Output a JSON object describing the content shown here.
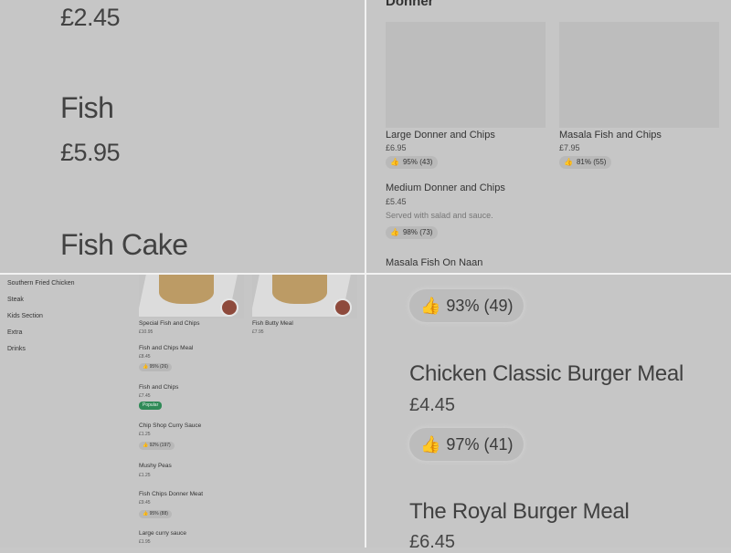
{
  "q1": {
    "top_price": "£2.45",
    "fish_name": "Fish",
    "fish_price": "£5.95",
    "fishcake_name": "Fish Cake"
  },
  "q2": {
    "section_title": "Donner",
    "items": [
      {
        "name": "Large Donner and Chips",
        "price": "£6.95",
        "rating": "95% (43)"
      },
      {
        "name": "Masala Fish and Chips",
        "price": "£7.95",
        "rating": "81% (55)"
      },
      {
        "name": "Medium Donner and Chips",
        "price": "£5.45",
        "description": "Served with salad and sauce.",
        "rating": "98% (73)"
      },
      {
        "name": "Masala Fish On Naan"
      }
    ]
  },
  "q3": {
    "categories": [
      "Southern Fried Chicken",
      "Steak",
      "Kids Section",
      "Extra",
      "Drinks"
    ],
    "items": [
      {
        "name": "Special Fish and Chips",
        "price": "£10.95"
      },
      {
        "name": "Fish Butty Meal",
        "price": "£7.95"
      },
      {
        "name": "Fish and Chips Meal",
        "price": "£8.45",
        "rating": "95% (26)"
      },
      {
        "name": "Fish and Chips",
        "price": "£7.45",
        "badge": "Popular"
      },
      {
        "name": "Chip Shop Curry Sauce",
        "price": "£1.25",
        "rating": "92% (197)"
      },
      {
        "name": "Mushy Peas",
        "price": "£1.25"
      },
      {
        "name": "Fish Chips Donner Meat",
        "price": "£9.45",
        "rating": "95% (88)"
      },
      {
        "name": "Large curry sauce",
        "price": "£1.95"
      }
    ]
  },
  "q4": {
    "rating_top": "93% (49)",
    "item1_name": "Chicken Classic Burger Meal",
    "item1_price": "£4.45",
    "item1_rating": "97% (41)",
    "item2_name": "The Royal Burger Meal",
    "item2_price": "£6.45"
  },
  "icons": {
    "thumb": "thumbs-up-icon"
  }
}
